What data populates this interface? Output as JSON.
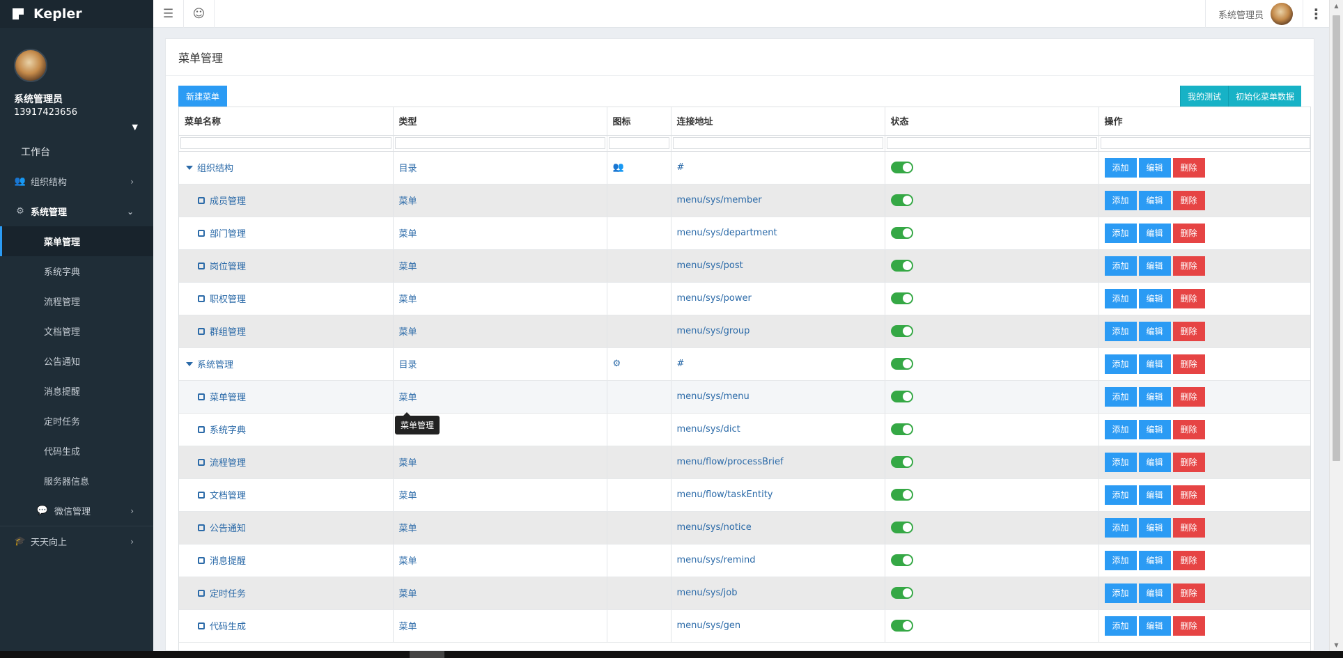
{
  "app": {
    "brand": "Kepler"
  },
  "profile": {
    "name": "系统管理员",
    "phone": "13917423656"
  },
  "sidebar": {
    "workbench": "工作台",
    "org": "组织结构",
    "sys": "系统管理",
    "sub_items": [
      "菜单管理",
      "系统字典",
      "流程管理",
      "文档管理",
      "公告通知",
      "消息提醒",
      "定时任务",
      "代码生成",
      "服务器信息"
    ],
    "wechat": "微信管理",
    "daily": "天天向上"
  },
  "topbar": {
    "user": "系统管理员"
  },
  "page": {
    "title": "菜单管理",
    "new_button": "新建菜单",
    "test_button": "我的测试",
    "init_button": "初始化菜单数据"
  },
  "table": {
    "headers": [
      "菜单名称",
      "类型",
      "图标",
      "连接地址",
      "状态",
      "操作"
    ],
    "actions": {
      "add": "添加",
      "edit": "编辑",
      "delete": "删除"
    },
    "rows": [
      {
        "name": "组织结构",
        "type": "目录",
        "icon": "users-icon",
        "url": "#",
        "level": 0
      },
      {
        "name": "成员管理",
        "type": "菜单",
        "icon": "",
        "url": "menu/sys/member",
        "level": 1
      },
      {
        "name": "部门管理",
        "type": "菜单",
        "icon": "",
        "url": "menu/sys/department",
        "level": 1
      },
      {
        "name": "岗位管理",
        "type": "菜单",
        "icon": "",
        "url": "menu/sys/post",
        "level": 1
      },
      {
        "name": "职权管理",
        "type": "菜单",
        "icon": "",
        "url": "menu/sys/power",
        "level": 1
      },
      {
        "name": "群组管理",
        "type": "菜单",
        "icon": "",
        "url": "menu/sys/group",
        "level": 1
      },
      {
        "name": "系统管理",
        "type": "目录",
        "icon": "gears-icon",
        "url": "#",
        "level": 0
      },
      {
        "name": "菜单管理",
        "type": "菜单",
        "icon": "",
        "url": "menu/sys/menu",
        "level": 1
      },
      {
        "name": "系统字典",
        "type": "菜单",
        "icon": "",
        "url": "menu/sys/dict",
        "level": 1
      },
      {
        "name": "流程管理",
        "type": "菜单",
        "icon": "",
        "url": "menu/flow/processBrief",
        "level": 1
      },
      {
        "name": "文档管理",
        "type": "菜单",
        "icon": "",
        "url": "menu/flow/taskEntity",
        "level": 1
      },
      {
        "name": "公告通知",
        "type": "菜单",
        "icon": "",
        "url": "menu/sys/notice",
        "level": 1
      },
      {
        "name": "消息提醒",
        "type": "菜单",
        "icon": "",
        "url": "menu/sys/remind",
        "level": 1
      },
      {
        "name": "定时任务",
        "type": "菜单",
        "icon": "",
        "url": "menu/sys/job",
        "level": 1
      },
      {
        "name": "代码生成",
        "type": "菜单",
        "icon": "",
        "url": "menu/sys/gen",
        "level": 1
      }
    ]
  },
  "tooltip": "菜单管理",
  "colors": {
    "primary": "#2b9bf4",
    "danger": "#e64444",
    "cyan": "#17b2c6",
    "sidebar": "#1f2d37",
    "toggle_on": "#35a845"
  }
}
